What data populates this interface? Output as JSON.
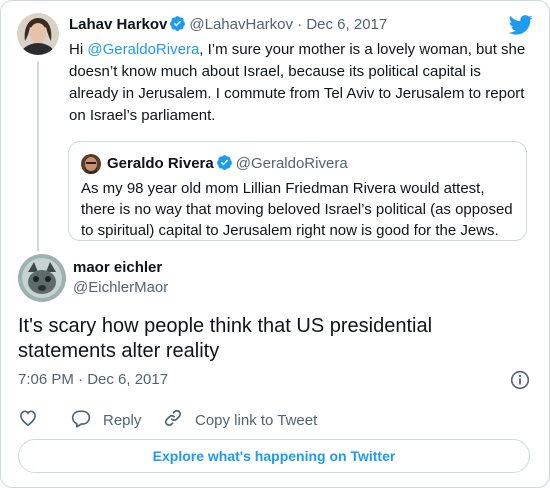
{
  "parent_tweet": {
    "author_name": "Lahav Harkov",
    "author_handle": "@LahavHarkov",
    "separator": "·",
    "date": "Dec 6, 2017",
    "text_before_mention": "Hi ",
    "mention": "@GeraldoRivera",
    "text_after_mention": ", I’m sure your mother is a lovely woman, but she doesn’t know much about Israel, because its political capital is already in Jerusalem. I commute from Tel Aviv to Jerusalem to report on Israel’s parliament.",
    "quoted": {
      "author_name": "Geraldo Rivera",
      "author_handle": "@GeraldoRivera",
      "text": "As my 98 year old mom Lillian Friedman Rivera would attest, there is no way that moving beloved Israel’s political (as opposed to spiritual) capital to Jerusalem right now is good for the Jews."
    }
  },
  "main_tweet": {
    "author_name": "maor eichler",
    "author_handle": "@EichlerMaor",
    "text": "It's scary how people think that US presidential statements alter reality",
    "timestamp": "7:06 PM · Dec 6, 2017"
  },
  "actions": {
    "reply_label": "Reply",
    "copy_link_label": "Copy link to Tweet"
  },
  "explore_label": "Explore what's happening on Twitter",
  "icons": {
    "brand": "twitter-bird-icon",
    "verified": "verified-badge-icon",
    "like": "heart-icon",
    "reply": "speech-bubble-icon",
    "copy_link": "link-icon",
    "info": "info-icon"
  },
  "colors": {
    "accent": "#1d9bf0",
    "text": "#0f1419",
    "muted": "#536471",
    "border": "#cfd9de"
  }
}
